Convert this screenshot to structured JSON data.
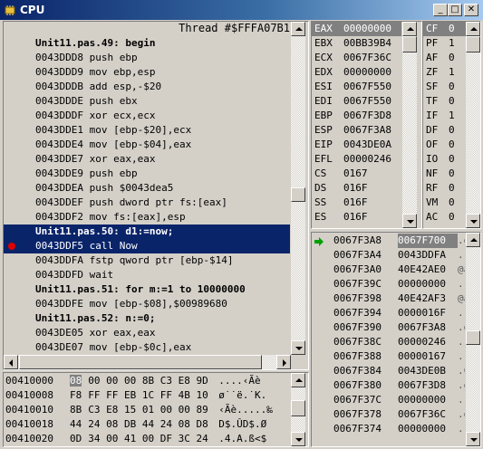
{
  "window": {
    "title": "CPU",
    "minimize": "_",
    "maximize": "□",
    "close": "✕"
  },
  "disasm": {
    "thread": "Thread #$FFFA07B1",
    "lines": [
      {
        "text": "Unit11.pas.49: begin",
        "src": true
      },
      {
        "text": "0043DDD8 push ebp"
      },
      {
        "text": "0043DDD9 mov ebp,esp"
      },
      {
        "text": "0043DDDB add esp,-$20"
      },
      {
        "text": "0043DDDE push ebx"
      },
      {
        "text": "0043DDDF xor ecx,ecx"
      },
      {
        "text": "0043DDE1 mov [ebp-$20],ecx"
      },
      {
        "text": "0043DDE4 mov [ebp-$04],eax"
      },
      {
        "text": "0043DDE7 xor eax,eax"
      },
      {
        "text": "0043DDE9 push ebp"
      },
      {
        "text": "0043DDEA push $0043dea5"
      },
      {
        "text": "0043DDEF push dword ptr fs:[eax]"
      },
      {
        "text": "0043DDF2 mov fs:[eax],esp"
      },
      {
        "text": "Unit11.pas.50: d1:=now;",
        "src": true,
        "selected": true
      },
      {
        "text": "0043DDF5 call Now",
        "selected": true,
        "breakpoint": true
      },
      {
        "text": "0043DDFA fstp qword ptr [ebp-$14]"
      },
      {
        "text": "0043DDFD wait"
      },
      {
        "text": "Unit11.pas.51: for m:=1 to 10000000",
        "src": true
      },
      {
        "text": "0043DDFE mov [ebp-$08],$00989680"
      },
      {
        "text": "Unit11.pas.52: n:=0;",
        "src": true
      },
      {
        "text": "0043DE05 xor eax,eax"
      },
      {
        "text": "0043DE07 mov [ebp-$0c],eax"
      }
    ]
  },
  "registers": [
    {
      "name": "EAX",
      "value": "00000000",
      "highlight": true
    },
    {
      "name": "EBX",
      "value": "00BB39B4"
    },
    {
      "name": "ECX",
      "value": "0067F36C"
    },
    {
      "name": "EDX",
      "value": "00000000"
    },
    {
      "name": "ESI",
      "value": "0067F550"
    },
    {
      "name": "EDI",
      "value": "0067F550"
    },
    {
      "name": "EBP",
      "value": "0067F3D8"
    },
    {
      "name": "ESP",
      "value": "0067F3A8"
    },
    {
      "name": "EIP",
      "value": "0043DE0A"
    },
    {
      "name": "EFL",
      "value": "00000246"
    },
    {
      "name": "CS",
      "value": "0167"
    },
    {
      "name": "DS",
      "value": "016F"
    },
    {
      "name": "SS",
      "value": "016F"
    },
    {
      "name": "ES",
      "value": "016F"
    }
  ],
  "flags": [
    {
      "name": "CF",
      "value": "0",
      "highlight": true
    },
    {
      "name": "PF",
      "value": "1"
    },
    {
      "name": "AF",
      "value": "0"
    },
    {
      "name": "ZF",
      "value": "1"
    },
    {
      "name": "SF",
      "value": "0"
    },
    {
      "name": "TF",
      "value": "0"
    },
    {
      "name": "IF",
      "value": "1"
    },
    {
      "name": "DF",
      "value": "0"
    },
    {
      "name": "OF",
      "value": "0"
    },
    {
      "name": "IO",
      "value": "0"
    },
    {
      "name": "NF",
      "value": "0"
    },
    {
      "name": "RF",
      "value": "0"
    },
    {
      "name": "VM",
      "value": "0"
    },
    {
      "name": "AC",
      "value": "0"
    }
  ],
  "memory": [
    {
      "addr": "00410000",
      "first": "08",
      "rest": "00 00 00 8B C3 E8 9D",
      "ascii": "....‹Ãè"
    },
    {
      "addr": "00410008",
      "first": "F8",
      "rest": "FF FF EB 1C FF 4B 10",
      "ascii": "ø˙˙ë.˙K."
    },
    {
      "addr": "00410010",
      "first": "8B",
      "rest": "C3 E8 15 01 00 00 89",
      "ascii": "‹Ãè.....‰"
    },
    {
      "addr": "00410018",
      "first": "44",
      "rest": "24 08 DB 44 24 08 D8",
      "ascii": "D$.ÛD$.Ø"
    },
    {
      "addr": "00410020",
      "first": "0D",
      "rest": "34 00 41 00 DF 3C 24",
      "ascii": ".4.A.ß<$"
    }
  ],
  "stack": [
    {
      "addr": "0067F3A8",
      "value": "0067F700",
      "ascii": ".g",
      "current": true
    },
    {
      "addr": "0067F3A4",
      "value": "0043DDFA",
      "ascii": "..C"
    },
    {
      "addr": "0067F3A0",
      "value": "40E42AE0",
      "ascii": "@à"
    },
    {
      "addr": "0067F39C",
      "value": "00000000",
      "ascii": "...."
    },
    {
      "addr": "0067F398",
      "value": "40E42AF3",
      "ascii": "@à"
    },
    {
      "addr": "0067F394",
      "value": "0000016F",
      "ascii": ".."
    },
    {
      "addr": "0067F390",
      "value": "0067F3A8",
      "ascii": ".g"
    },
    {
      "addr": "0067F38C",
      "value": "00000246",
      "ascii": ".."
    },
    {
      "addr": "0067F388",
      "value": "00000167",
      "ascii": ".."
    },
    {
      "addr": "0067F384",
      "value": "0043DE0B",
      "ascii": ".C"
    },
    {
      "addr": "0067F380",
      "value": "0067F3D8",
      "ascii": ".g"
    },
    {
      "addr": "0067F37C",
      "value": "00000000",
      "ascii": "...."
    },
    {
      "addr": "0067F378",
      "value": "0067F36C",
      "ascii": ".g"
    },
    {
      "addr": "0067F374",
      "value": "00000000",
      "ascii": "...."
    }
  ],
  "colors": {
    "selection": "#0a246a",
    "breakpoint": "#e00000",
    "face": "#d4d0c8",
    "stack_arrow": "#00a000"
  },
  "icons": {
    "app": "cpu-chip-icon",
    "current_stack": "green-arrow-icon",
    "breakpoint": "breakpoint-dot-icon"
  }
}
